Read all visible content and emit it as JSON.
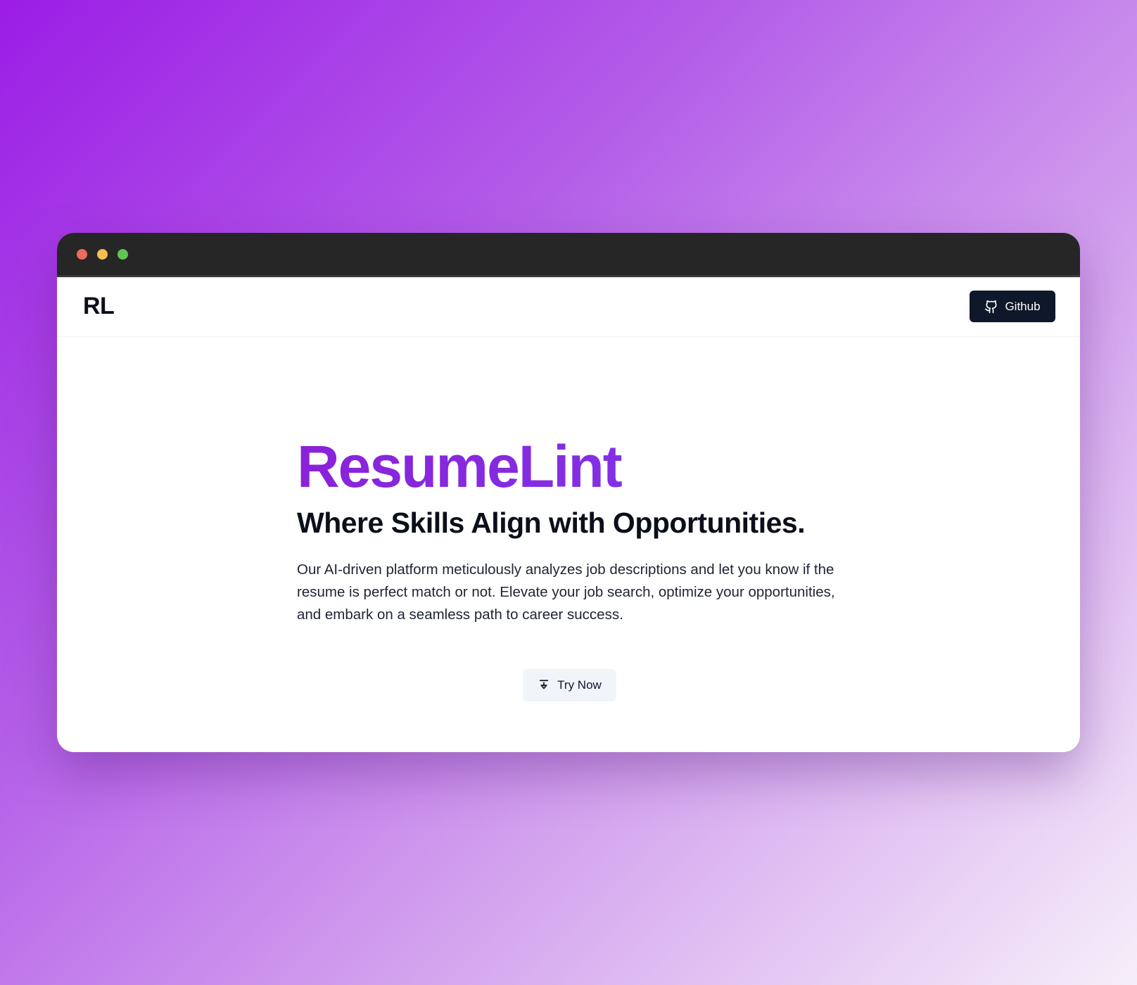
{
  "window": {
    "controls": [
      "close",
      "minimize",
      "maximize"
    ]
  },
  "navbar": {
    "logo": "RL",
    "github_button": {
      "label": "Github",
      "icon": "github-icon"
    }
  },
  "hero": {
    "title": "ResumeLint",
    "tagline": "Where Skills Align with Opportunities.",
    "description": "Our AI-driven platform meticulously analyzes job descriptions and let you know if the resume is perfect match or not. Elevate your job search, optimize your opportunities, and embark on a seamless path to career success.",
    "cta_button": {
      "label": "Try Now",
      "icon": "arrow-down-to-line-icon"
    }
  },
  "colors": {
    "brand_purple": "#8a22d9",
    "dark_button": "#0f172a",
    "light_button": "#f1f5f9",
    "titlebar": "#262626"
  }
}
